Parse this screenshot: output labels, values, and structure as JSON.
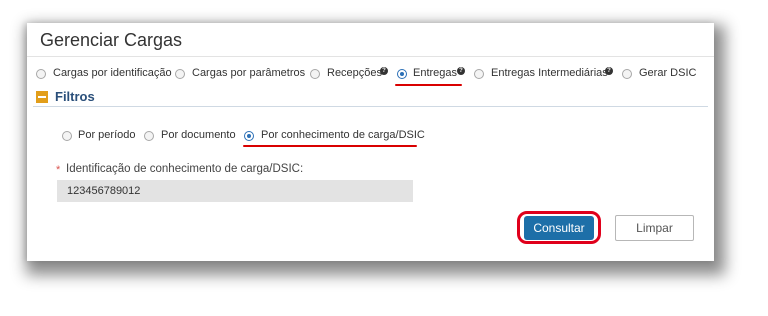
{
  "page": {
    "title": "Gerenciar Cargas"
  },
  "top_options": [
    {
      "label": "Cargas por identificação",
      "checked": false,
      "help": false
    },
    {
      "label": "Cargas por parâmetros",
      "checked": false,
      "help": false
    },
    {
      "label": "Recepções",
      "checked": false,
      "help": true
    },
    {
      "label": "Entregas",
      "checked": true,
      "help": true
    },
    {
      "label": "Entregas Intermediárias",
      "checked": false,
      "help": true
    },
    {
      "label": "Gerar DSIC",
      "checked": false,
      "help": false
    }
  ],
  "help_glyph": "?",
  "filtros": {
    "title": "Filtros",
    "options": [
      {
        "label": "Por período",
        "checked": false
      },
      {
        "label": "Por documento",
        "checked": false
      },
      {
        "label": "Por conhecimento de carga/DSIC",
        "checked": true
      }
    ]
  },
  "field": {
    "required_mark": "*",
    "label": "Identificação de conhecimento de carga/DSIC:",
    "value": "123456789012"
  },
  "buttons": {
    "consultar": "Consultar",
    "limpar": "Limpar"
  },
  "colors": {
    "accent_blue": "#1d6fa8",
    "highlight_red": "#e0001b",
    "filtros_orange": "#e29e1a"
  }
}
